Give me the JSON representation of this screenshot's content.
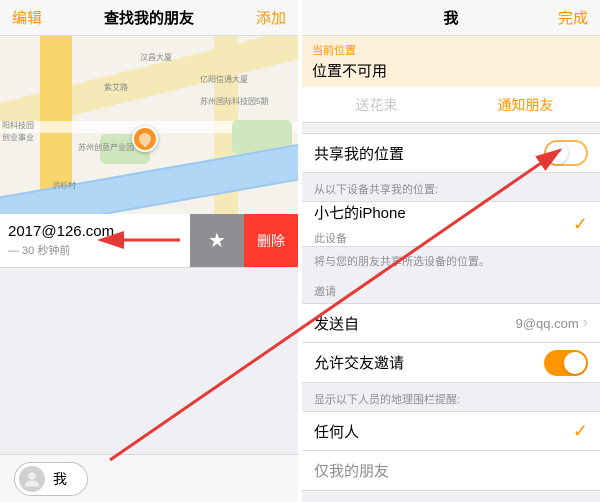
{
  "left": {
    "nav": {
      "left": "编辑",
      "title": "查找我的朋友",
      "right": "添加"
    },
    "map": {
      "labels": [
        "汉昌大厦",
        "紫艾路",
        "亿阳信通大厦",
        "苏州国际科技园5期",
        "阳科技园",
        "创业事业",
        "苏州创意产业园",
        "洪杉村"
      ]
    },
    "friend": {
      "email": "2017@126.com",
      "sub": "— 30 秒钟前",
      "star": "★",
      "delete": "删除"
    },
    "me": "我"
  },
  "right": {
    "nav": {
      "left": "",
      "title": "我",
      "right": "完成"
    },
    "banner": {
      "title": "当前位置",
      "sub": "位置不可用"
    },
    "subnav": {
      "left": "送花束",
      "right": "通知朋友"
    },
    "share": {
      "label": "共享我的位置"
    },
    "device": {
      "header": "从以下设备共享我的位置:",
      "name": "小七的iPhone",
      "sub": "此设备",
      "note": "将与您的朋友共享所选设备的位置。"
    },
    "invite_header": "邀请",
    "sendfrom": {
      "label": "发送自",
      "value": "9@qq.com"
    },
    "allow": {
      "label": "允许交友邀请"
    },
    "geo_header": "显示以下人员的地理围栏提醒:",
    "anyone": "任何人",
    "friends": "仅我的朋友"
  }
}
